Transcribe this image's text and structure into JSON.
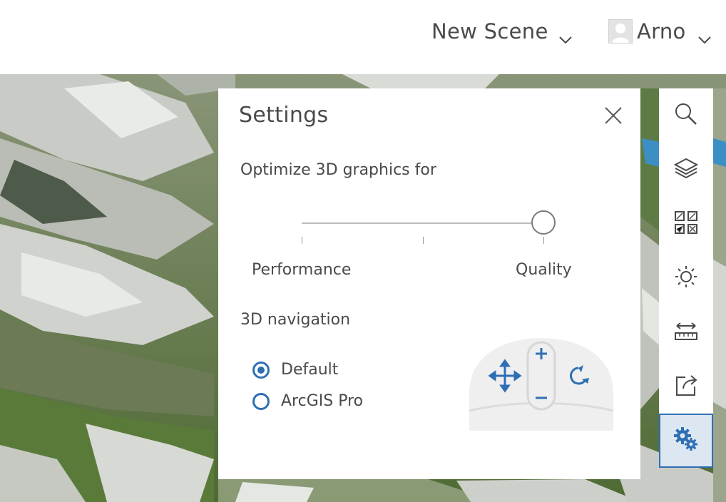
{
  "header": {
    "scene_menu": "New Scene",
    "user_menu": "Arno"
  },
  "settings_panel": {
    "title": "Settings",
    "optimize_label": "Optimize 3D graphics for",
    "slider": {
      "min_label": "Performance",
      "max_label": "Quality",
      "value": "Quality",
      "value_fraction": 1.0
    },
    "navigation_label": "3D navigation",
    "navigation_options": [
      {
        "label": "Default",
        "checked": true
      },
      {
        "label": "ArcGIS Pro",
        "checked": false
      }
    ]
  },
  "toolbar": {
    "tools": [
      {
        "name": "search-icon"
      },
      {
        "name": "layers-icon"
      },
      {
        "name": "basemap-gallery-icon"
      },
      {
        "name": "daylight-icon"
      },
      {
        "name": "measure-icon"
      },
      {
        "name": "share-icon"
      },
      {
        "name": "settings-icon",
        "active": true
      }
    ]
  },
  "colors": {
    "accent": "#2e6fb4",
    "active_tool_bg": "#dce7f2"
  }
}
